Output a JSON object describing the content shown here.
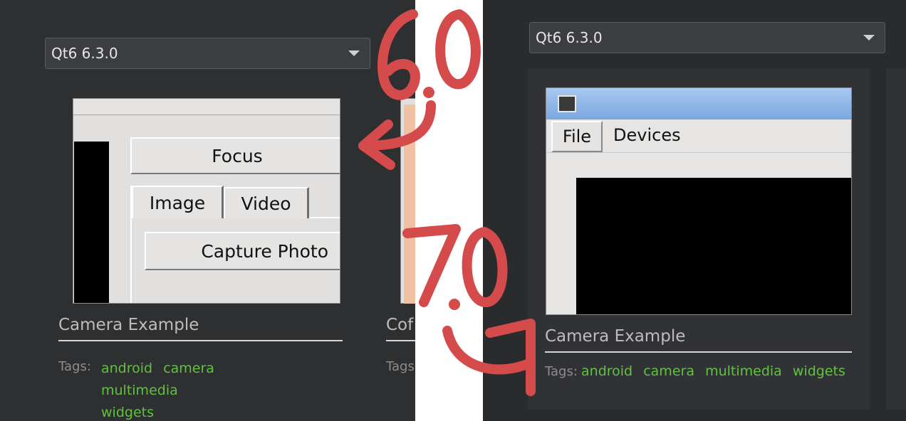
{
  "left": {
    "version_combo": "Qt6 6.3.0",
    "thumbnail": {
      "focus_label": "Focus",
      "tab_image": "Image",
      "tab_video": "Video",
      "capture_label": "Capture Photo"
    },
    "title": "Camera Example",
    "tags_label": "Tags:",
    "tags": [
      "android",
      "camera",
      "multimedia",
      "widgets"
    ],
    "partial_title": "Cof",
    "partial_tags_label": "Tags:"
  },
  "right": {
    "version_combo": "Qt6 6.3.0",
    "thumbnail": {
      "menu_file": "File",
      "menu_devices": "Devices"
    },
    "title": "Camera Example",
    "tags_label": "Tags:",
    "tags": [
      "android",
      "camera",
      "multimedia",
      "widgets"
    ]
  },
  "annotations": {
    "top_version": "6.0",
    "bottom_version": "7.0"
  },
  "colors": {
    "tag_green": "#61c23f",
    "annotation_red": "#d54a4a",
    "background_dark": "#2e2f31"
  }
}
